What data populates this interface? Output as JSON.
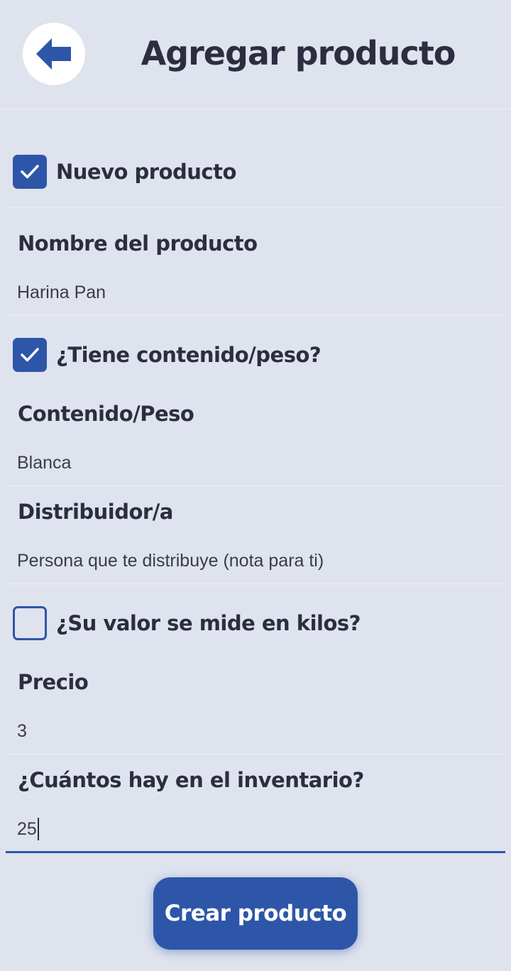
{
  "header": {
    "title": "Agregar producto",
    "back_icon": "arrow-left-icon"
  },
  "form": {
    "new_product": {
      "label": "Nuevo producto",
      "checked": true
    },
    "product_name": {
      "label": "Nombre del producto",
      "value": "Harina Pan"
    },
    "has_content": {
      "label": "¿Tiene contenido/peso?",
      "checked": true
    },
    "content_weight": {
      "label": "Contenido/Peso",
      "value": "Blanca"
    },
    "distributor": {
      "label": "Distribuidor/a",
      "value": "",
      "placeholder": "Persona que te distribuye (nota para ti)"
    },
    "by_kilo": {
      "label": "¿Su valor se mide en kilos?",
      "checked": false
    },
    "price": {
      "label": "Precio",
      "value": "3"
    },
    "inventory": {
      "label": "¿Cuántos hay en el inventario?",
      "value": "25"
    }
  },
  "submit_label": "Crear producto",
  "colors": {
    "accent": "#2d56a8",
    "background": "#dfe3ee",
    "text": "#2c2e3f",
    "divider": "#e6e8ee"
  }
}
